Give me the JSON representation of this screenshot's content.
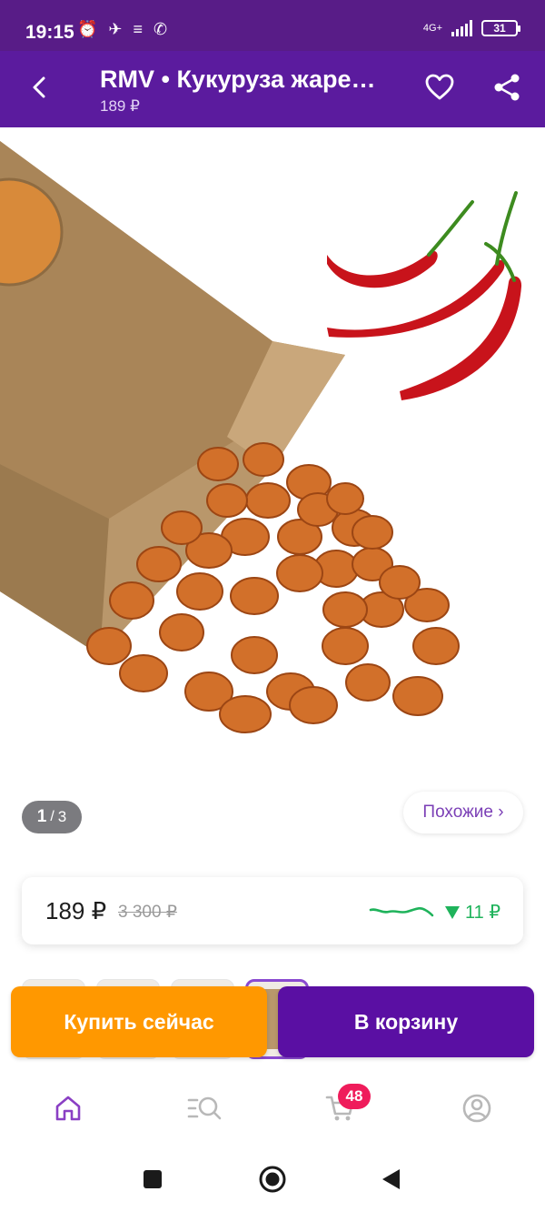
{
  "status_bar": {
    "time": "19:15",
    "network": "4G+",
    "battery": "31"
  },
  "header": {
    "title": "RMV • Кукуруза жаре…",
    "price": "189 ₽",
    "icons": [
      "back-arrow-icon",
      "heart-icon",
      "share-icon"
    ]
  },
  "gallery": {
    "current": "1",
    "separator": "/",
    "total": "3",
    "similar_label": "Похожие ›"
  },
  "price_card": {
    "price": "189 ₽",
    "old_price": "3 300 ₽",
    "delta": "11 ₽",
    "trend_color": "#1fb35b"
  },
  "actions": {
    "buy_now_label": "Купить сейчас",
    "cart_label": "В корзину",
    "buy_color": "#ff9800",
    "cart_color": "#5a0fa3"
  },
  "bottom_nav": {
    "items": [
      "home-icon",
      "catalog-search-icon",
      "cart-icon",
      "profile-icon"
    ],
    "cart_badge": "48",
    "accent": "#8a3fc4"
  },
  "system_nav": {
    "items": [
      "recents-square-icon",
      "home-circle-icon",
      "back-triangle-icon"
    ]
  }
}
